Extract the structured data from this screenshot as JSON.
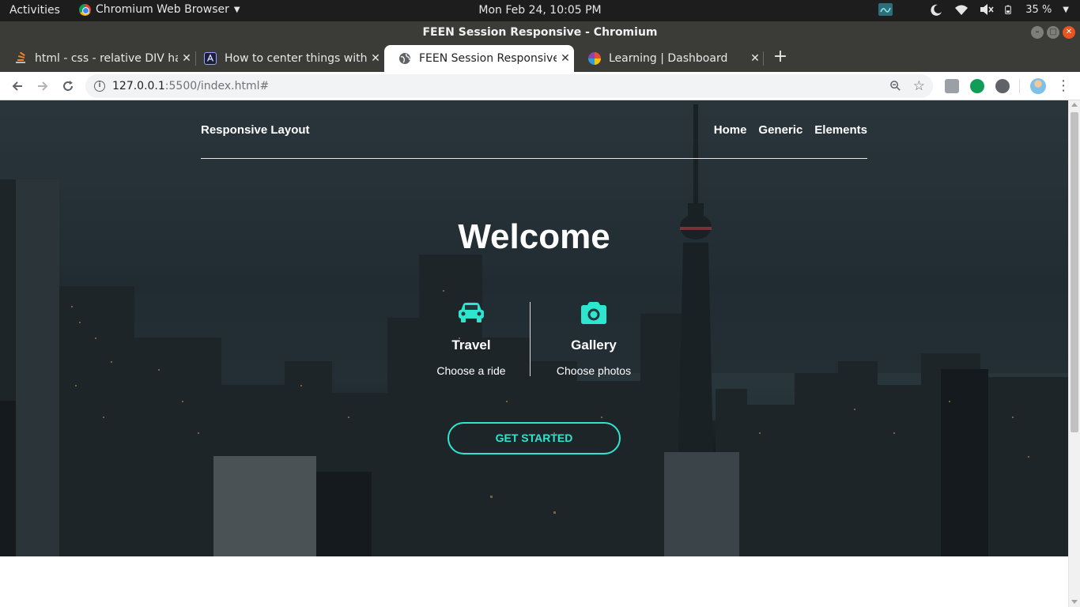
{
  "system_bar": {
    "activities": "Activities",
    "app_name": "Chromium Web Browser",
    "clock": "Mon Feb 24, 10:05 PM",
    "battery": "35 %"
  },
  "window": {
    "title": "FEEN Session Responsive - Chromium"
  },
  "tabs": [
    {
      "label": "html - css - relative DIV has",
      "favicon_color": "#f48024",
      "active": false
    },
    {
      "label": "How to center things with",
      "favicon_color": "#1b1f3a",
      "active": false
    },
    {
      "label": "FEEN Session Responsive",
      "favicon_color": "#5f6368",
      "active": true
    },
    {
      "label": "Learning | Dashboard",
      "favicon_color": "#8e44ad",
      "active": false
    }
  ],
  "toolbar": {
    "url_host": "127.0.0.1",
    "url_path": ":5500/index.html#"
  },
  "site": {
    "brand": "Responsive Layout",
    "nav": [
      "Home",
      "Generic",
      "Elements"
    ],
    "hero_title": "Welcome",
    "features": [
      {
        "title": "Travel",
        "desc": "Choose a ride",
        "icon": "car-icon"
      },
      {
        "title": "Gallery",
        "desc": "Choose photos",
        "icon": "camera-icon"
      }
    ],
    "cta_label": "GET STARTED"
  },
  "colors": {
    "accent": "#2ee6d0",
    "hero_overlay": "#1e272b",
    "tab_strip": "#3b3b37",
    "system_bar": "#1d1d1d",
    "close_button": "#e95420"
  }
}
